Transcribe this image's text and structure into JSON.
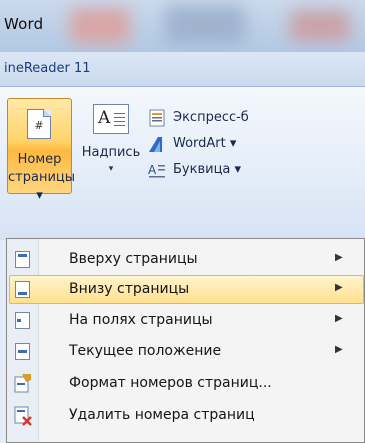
{
  "window": {
    "title": "Word"
  },
  "tabs": {
    "active_label": "ineReader 11"
  },
  "ribbon": {
    "page_number_button": {
      "line1": "Номер",
      "line2": "страницы ▾",
      "icon_text": "#"
    },
    "textbox_button": {
      "label": "Надпись",
      "arrow": "▾",
      "icon_text": "A"
    },
    "quick_parts": {
      "label": "Экспресс-б"
    },
    "wordart": {
      "label": "WordArt ▾"
    },
    "dropcap": {
      "label": "Буквица ▾"
    }
  },
  "menu": {
    "items": [
      {
        "label": "Вверху страницы",
        "submenu": "▶"
      },
      {
        "label": "Внизу страницы",
        "submenu": "▶"
      },
      {
        "label": "На полях страницы",
        "submenu": "▶"
      },
      {
        "label": "Текущее положение",
        "submenu": "▶"
      },
      {
        "label": "Формат номеров страниц...",
        "submenu": ""
      },
      {
        "label": "Удалить номера страниц",
        "submenu": ""
      }
    ]
  },
  "colors": {
    "highlight": "#ffe08d",
    "ribbon_bg": "#e3ecf8",
    "delete_icon": "#d23a2a"
  }
}
